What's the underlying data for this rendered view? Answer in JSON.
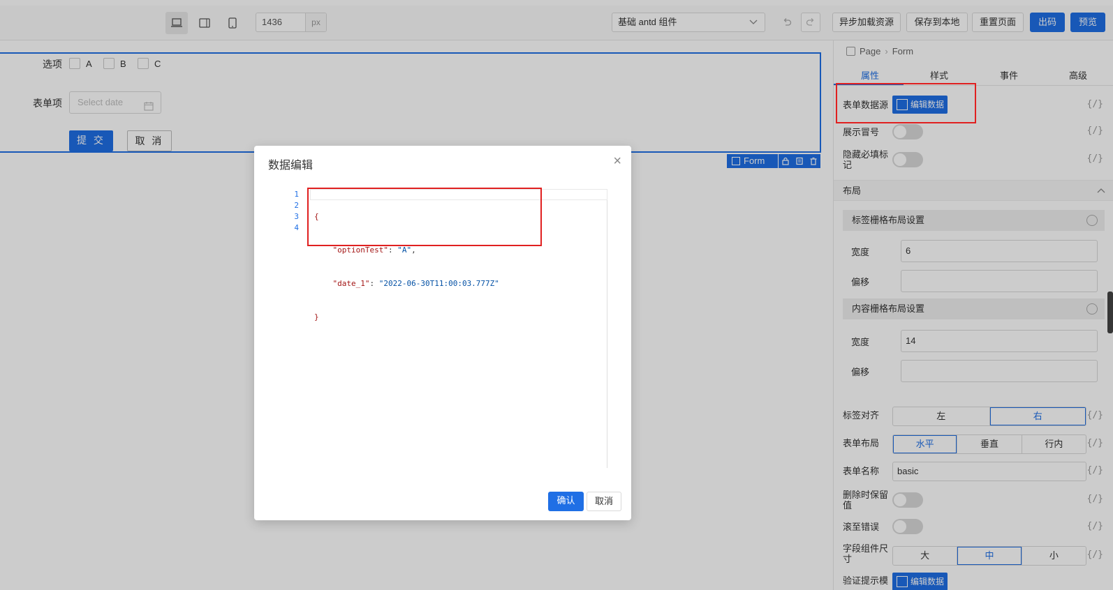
{
  "toolbar": {
    "width_value": "1436",
    "width_unit": "px",
    "component_select": "基础 antd 组件",
    "async_load": "异步加载资源",
    "save_local": "保存到本地",
    "reset_page": "重置页面",
    "export_code": "出码",
    "preview": "预览"
  },
  "form": {
    "option_label": "选项",
    "options": [
      "A",
      "B",
      "C"
    ],
    "item_label": "表单项",
    "date_placeholder": "Select date",
    "submit": "提 交",
    "cancel": "取 消",
    "tag": "Form"
  },
  "panel": {
    "breadcrumb": [
      "Page",
      "Form"
    ],
    "tabs": [
      "属性",
      "样式",
      "事件",
      "高级"
    ],
    "data_source_label": "表单数据源",
    "edit_data": "编辑数据",
    "show_colon": "展示冒号",
    "hide_required_1": "隐藏必填标",
    "hide_required_2": "记",
    "layout_section": "布局",
    "label_grid": "标签栅格布局设置",
    "content_grid": "内容栅格布局设置",
    "width_label": "宽度",
    "offset_label": "偏移",
    "label_width": "6",
    "content_width": "14",
    "label_align": "标签对齐",
    "align_options": [
      "左",
      "右"
    ],
    "form_layout": "表单布局",
    "layout_options": [
      "水平",
      "垂直",
      "行内"
    ],
    "form_name_label": "表单名称",
    "form_name": "basic",
    "preserve_1": "删除时保留",
    "preserve_2": "值",
    "scroll_error": "滚至错误",
    "size_1": "字段组件尺",
    "size_2": "寸",
    "size_options": [
      "大",
      "中",
      "小"
    ],
    "validate": "验证提示模",
    "code_icon": "{/}"
  },
  "modal": {
    "title": "数据编辑",
    "line_numbers": [
      "1",
      "2",
      "3",
      "4"
    ],
    "json_lines": [
      "{",
      "\"optionTest\": \"A\",",
      "\"date_1\": \"2022-06-30T11:00:03.777Z\"",
      "}"
    ],
    "key1": "\"optionTest\"",
    "val1": "\"A\"",
    "key2": "\"date_1\"",
    "val2": "\"2022-06-30T11:00:03.777Z\"",
    "confirm": "确认",
    "cancel": "取消"
  },
  "colors": {
    "primary": "#1f6fe5",
    "highlight": "#e02020"
  }
}
